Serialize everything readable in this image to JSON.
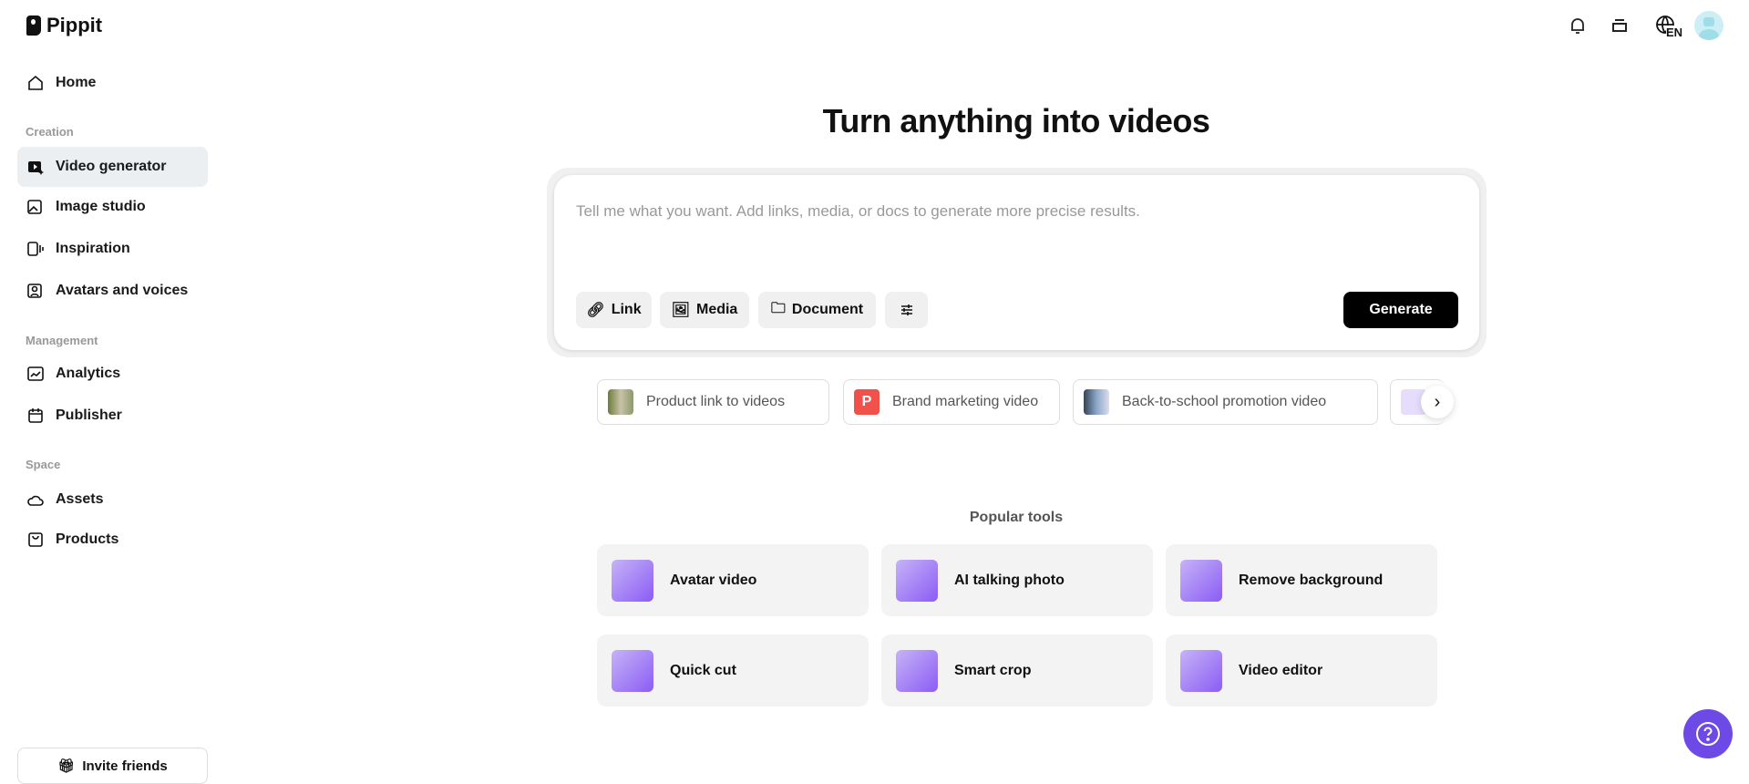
{
  "brand": "Pippit",
  "sidebar": {
    "home": "Home",
    "sections": {
      "creation": "Creation",
      "management": "Management",
      "space": "Space"
    },
    "items": {
      "video_generator": "Video generator",
      "image_studio": "Image studio",
      "inspiration": "Inspiration",
      "avatars": "Avatars and voices",
      "analytics": "Analytics",
      "publisher": "Publisher",
      "assets": "Assets",
      "products": "Products"
    },
    "invite": "Invite friends"
  },
  "header": {
    "lang": "EN"
  },
  "main": {
    "title": "Turn anything into videos",
    "prompt_placeholder": "Tell me what you want. Add links, media, or docs to generate more precise results.",
    "buttons": {
      "link": "Link",
      "media": "Media",
      "document": "Document",
      "generate": "Generate"
    },
    "chips": [
      "Product link to videos",
      "Brand marketing video",
      "Back-to-school promotion video"
    ],
    "chip_badge": "P",
    "popular_title": "Popular tools",
    "tools": [
      "Avatar video",
      "AI talking photo",
      "Remove background",
      "Quick cut",
      "Smart crop",
      "Video editor"
    ]
  },
  "colors": {
    "accent": "#6d4ae6",
    "active_nav": "#ebeff2",
    "chip_red": "#f0514a"
  }
}
